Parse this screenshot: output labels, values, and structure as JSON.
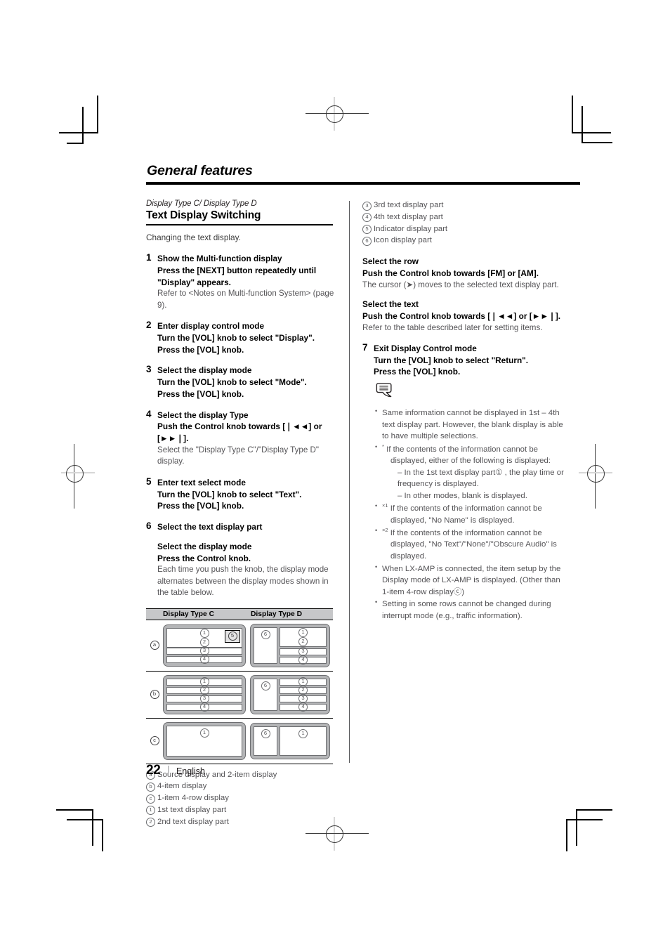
{
  "header": {
    "running_head": "General features"
  },
  "left_column": {
    "subtitle": "Display Type C/ Display Type D",
    "section_title": "Text Display Switching",
    "lead": "Changing the text display.",
    "steps": [
      {
        "num": "1",
        "bold": "Show the Multi-function display\nPress the [NEXT] button repeatedly until \"Display\" appears.",
        "note": "Refer to <Notes on Multi-function System> (page 9)."
      },
      {
        "num": "2",
        "bold": "Enter display control mode\nTurn the [VOL] knob to select \"Display\".\nPress the [VOL] knob.",
        "note": ""
      },
      {
        "num": "3",
        "bold": "Select the display mode\nTurn the [VOL] knob to select \"Mode\".\nPress the [VOL] knob.",
        "note": ""
      },
      {
        "num": "4",
        "bold": "Select the display Type\nPush the Control knob towards [❘◄◄] or [►►❘].",
        "note": "Select the \"Display Type C\"/\"Display Type D\" display."
      },
      {
        "num": "5",
        "bold": "Enter text select mode\nTurn the [VOL] knob to select \"Text\".\nPress the [VOL] knob.",
        "note": ""
      },
      {
        "num": "6",
        "bold": "Select the text display part",
        "note": ""
      }
    ],
    "step6_sub": {
      "bold": "Select the display mode\nPress the Control knob.",
      "note": "Each time you push the knob, the display mode alternates between the display modes shown in the table below."
    },
    "legend": [
      {
        "mark": "a",
        "text": "Source display and 2-item display"
      },
      {
        "mark": "b",
        "text": "4-item display"
      },
      {
        "mark": "c",
        "text": "1-item 4-row display"
      },
      {
        "mark": "1",
        "text": "1st text display part"
      },
      {
        "mark": "2",
        "text": "2nd text display part"
      }
    ]
  },
  "display_table": {
    "headers": [
      "Display Type C",
      "Display Type D"
    ],
    "rows": [
      {
        "label": "a",
        "type_c": {
          "layout": "source-2item",
          "parts": [
            "1",
            "2",
            "3",
            "4"
          ],
          "indicator": "5"
        },
        "type_d": {
          "layout": "icon-source-2item",
          "icon": "6",
          "parts": [
            "1",
            "2",
            "3",
            "4"
          ]
        }
      },
      {
        "label": "b",
        "type_c": {
          "layout": "4item",
          "parts": [
            "1",
            "2",
            "3",
            "4"
          ]
        },
        "type_d": {
          "layout": "icon-4item",
          "icon": "6",
          "parts": [
            "1",
            "2",
            "3",
            "4"
          ]
        }
      },
      {
        "label": "c",
        "type_c": {
          "layout": "1item-4row",
          "parts": [
            "1"
          ]
        },
        "type_d": {
          "layout": "icon-1item-4row",
          "icon": "6",
          "parts": [
            "1"
          ]
        }
      }
    ]
  },
  "right_column": {
    "legend": [
      {
        "mark": "3",
        "text": "3rd text display part"
      },
      {
        "mark": "4",
        "text": "4th text display part"
      },
      {
        "mark": "5",
        "text": "Indicator display part"
      },
      {
        "mark": "6",
        "text": "Icon display part"
      }
    ],
    "select_row": {
      "bold": "Select the row\nPush the Control knob towards [FM] or [AM].",
      "note": "The cursor (➤) moves to the selected text display part."
    },
    "select_text": {
      "bold": "Select the text\nPush the Control knob towards [❘◄◄] or [►►❘].",
      "note": "Refer to the table described later for setting items."
    },
    "step7": {
      "num": "7",
      "bold": "Exit Display Control mode\nTurn the [VOL] knob to select \"Return\".\nPress the [VOL] knob."
    },
    "notes": [
      {
        "main": "Same information cannot be displayed in 1st – 4th text display part. However, the blank display is able to have multiple selections."
      },
      {
        "marker": "*",
        "main": "If the contents of the information cannot be",
        "indent": "displayed, either of the following is displayed:",
        "sub": [
          "– In the 1st text display part① , the play time or frequency is displayed.",
          "– In other modes, blank is displayed."
        ]
      },
      {
        "marker": "×1",
        "main": "If the contents of the information cannot be",
        "indent": "displayed, \"No Name\" is displayed."
      },
      {
        "marker": "×2",
        "main": "If the contents of the information cannot be",
        "indent": "displayed, \"No Text\"/\"None\"/\"Obscure Audio\" is displayed."
      },
      {
        "main": "When LX-AMP is connected, the item setup by the Display mode of LX-AMP is displayed. (Other than 1-item 4-row displayⓒ)"
      },
      {
        "main": "Setting in some rows cannot be changed during interrupt mode (e.g., traffic information)."
      }
    ]
  },
  "footer": {
    "page_number": "22",
    "separator": "|",
    "language": "English"
  }
}
